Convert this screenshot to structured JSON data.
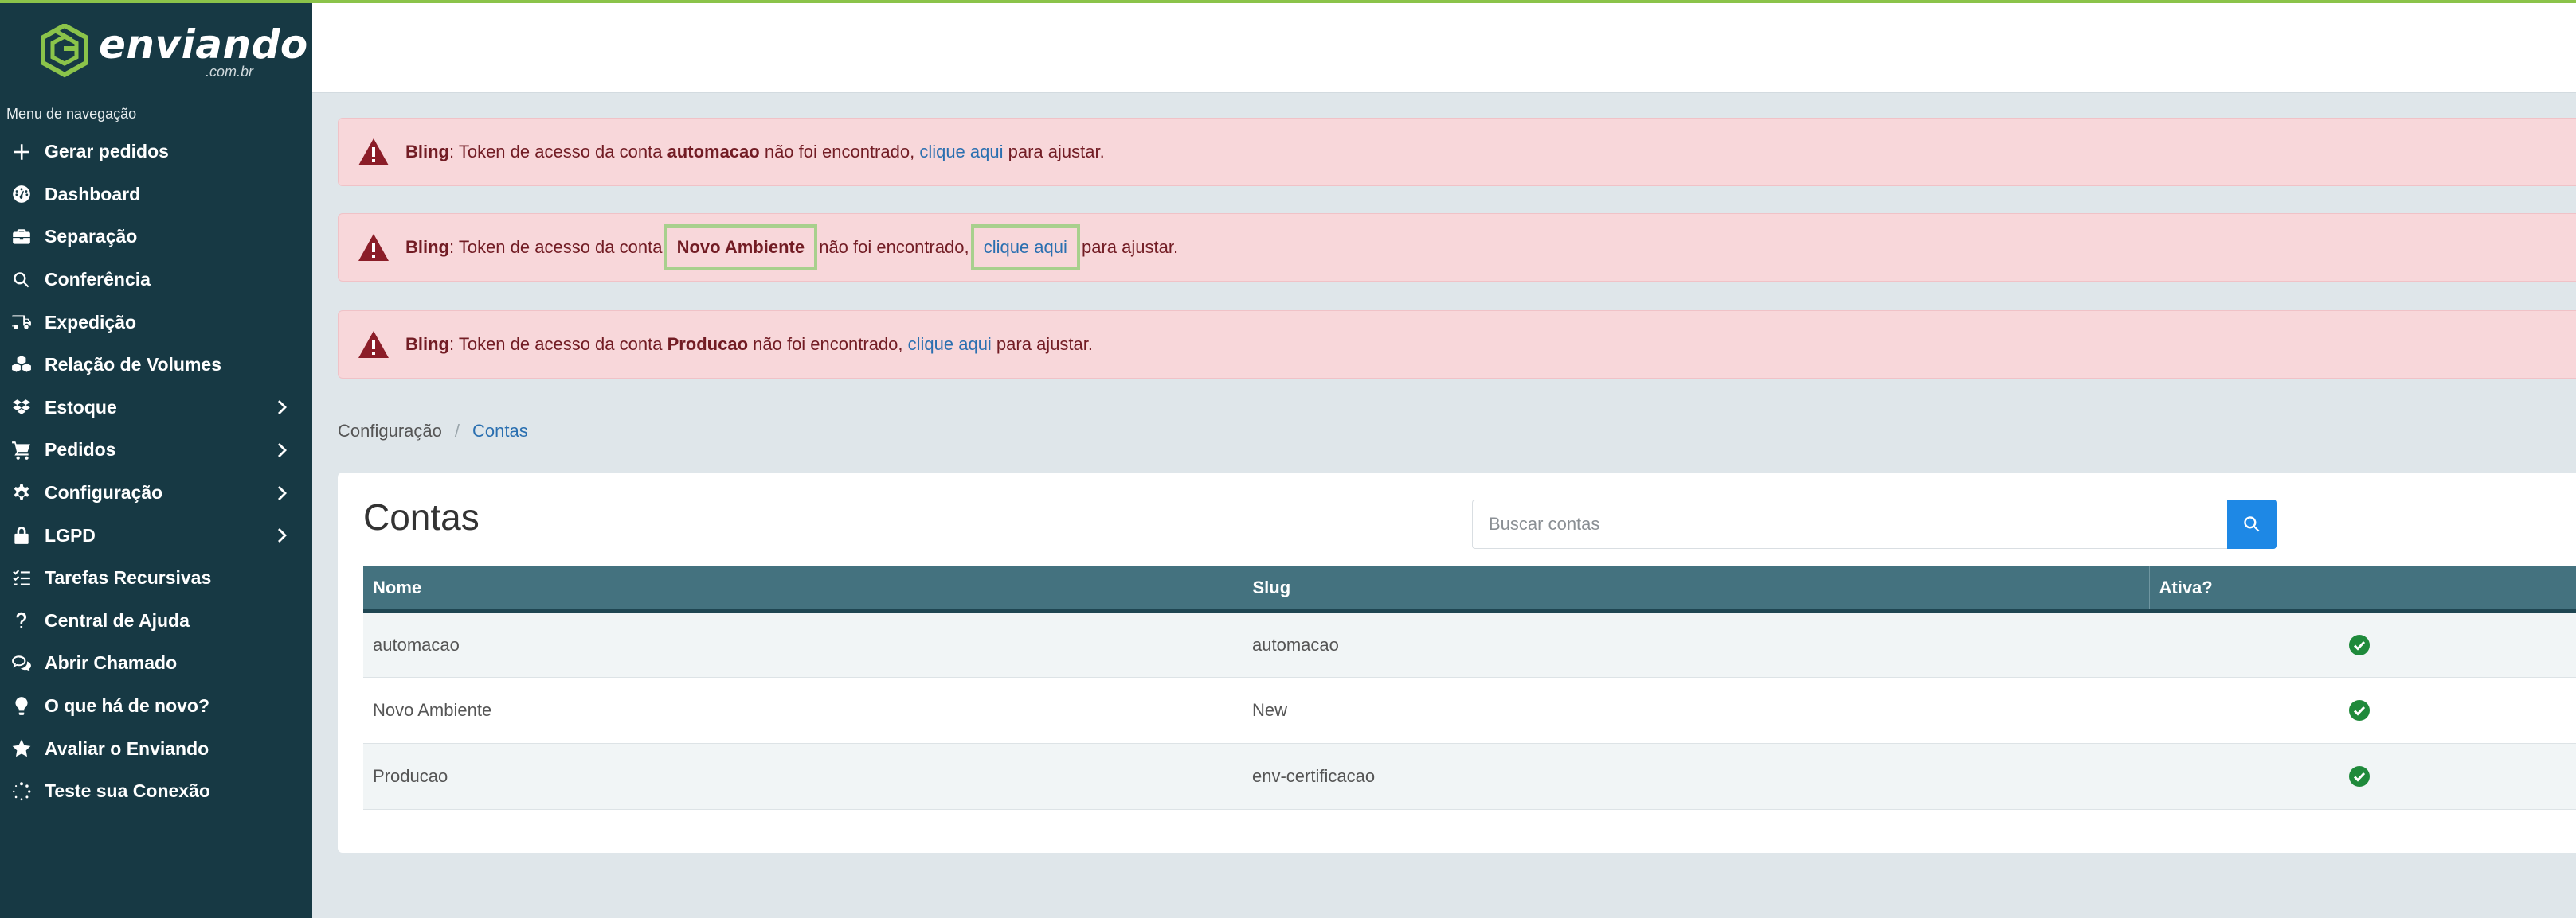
{
  "brand": {
    "name": "enviando",
    "domain": ".com.br",
    "accent": "#8bc34a"
  },
  "sidebar": {
    "caption": "Menu de navegação",
    "items": [
      {
        "label": "Gerar pedidos",
        "icon": "plus-icon",
        "has_submenu": false
      },
      {
        "label": "Dashboard",
        "icon": "gauge-icon",
        "has_submenu": false
      },
      {
        "label": "Separação",
        "icon": "briefcase-icon",
        "has_submenu": false
      },
      {
        "label": "Conferência",
        "icon": "search-icon",
        "has_submenu": false
      },
      {
        "label": "Expedição",
        "icon": "truck-icon",
        "has_submenu": false
      },
      {
        "label": "Relação de Volumes",
        "icon": "cubes-icon",
        "has_submenu": false
      },
      {
        "label": "Estoque",
        "icon": "dropbox-icon",
        "has_submenu": true
      },
      {
        "label": "Pedidos",
        "icon": "cart-icon",
        "has_submenu": true
      },
      {
        "label": "Configuração",
        "icon": "gear-icon",
        "has_submenu": true
      },
      {
        "label": "LGPD",
        "icon": "lock-icon",
        "has_submenu": true
      },
      {
        "label": "Tarefas Recursivas",
        "icon": "task-list-icon",
        "has_submenu": false
      },
      {
        "label": "Central de Ajuda",
        "icon": "question-icon",
        "has_submenu": false
      },
      {
        "label": "Abrir Chamado",
        "icon": "chat-icon",
        "has_submenu": false
      },
      {
        "label": "O que há de novo?",
        "icon": "lightbulb-icon",
        "has_submenu": false
      },
      {
        "label": "Avaliar o Enviando",
        "icon": "star-icon",
        "has_submenu": false
      },
      {
        "label": "Teste sua Conexão",
        "icon": "spinner-icon",
        "has_submenu": false
      }
    ]
  },
  "alerts": [
    {
      "source": "Bling",
      "text_before": ": Token de acesso da conta ",
      "account": "automacao",
      "text_middle": " não foi encontrado, ",
      "link": "clique aqui",
      "text_after": " para ajustar."
    },
    {
      "source": "Bling",
      "text_before": ": Token de acesso da conta ",
      "account": "Novo Ambiente",
      "text_middle": " não foi encontrado, ",
      "link": "clique aqui",
      "text_after": " para ajustar."
    },
    {
      "source": "Bling",
      "text_before": ": Token de acesso da conta ",
      "account": "Producao",
      "text_middle": " não foi encontrado, ",
      "link": "clique aqui",
      "text_after": " para ajustar."
    }
  ],
  "breadcrumb": {
    "parent": "Configuração",
    "separator": "/",
    "current": "Contas"
  },
  "page": {
    "title": "Contas",
    "search_placeholder": "Buscar contas"
  },
  "table": {
    "headers": [
      "Nome",
      "Slug",
      "Ativa?"
    ],
    "rows": [
      {
        "nome": "automacao",
        "slug": "automacao",
        "ativa": true
      },
      {
        "nome": "Novo Ambiente",
        "slug": "New",
        "ativa": true
      },
      {
        "nome": "Producao",
        "slug": "env-certificacao",
        "ativa": true
      }
    ]
  },
  "colors": {
    "sidebar_bg": "#173944",
    "alert_bg": "#f8d7da",
    "alert_text": "#721c24",
    "link": "#2a6fb0",
    "table_header": "#44727f",
    "search_button": "#1e88e5",
    "active_check": "#1f8a3b",
    "highlight": "#a8d08d"
  }
}
